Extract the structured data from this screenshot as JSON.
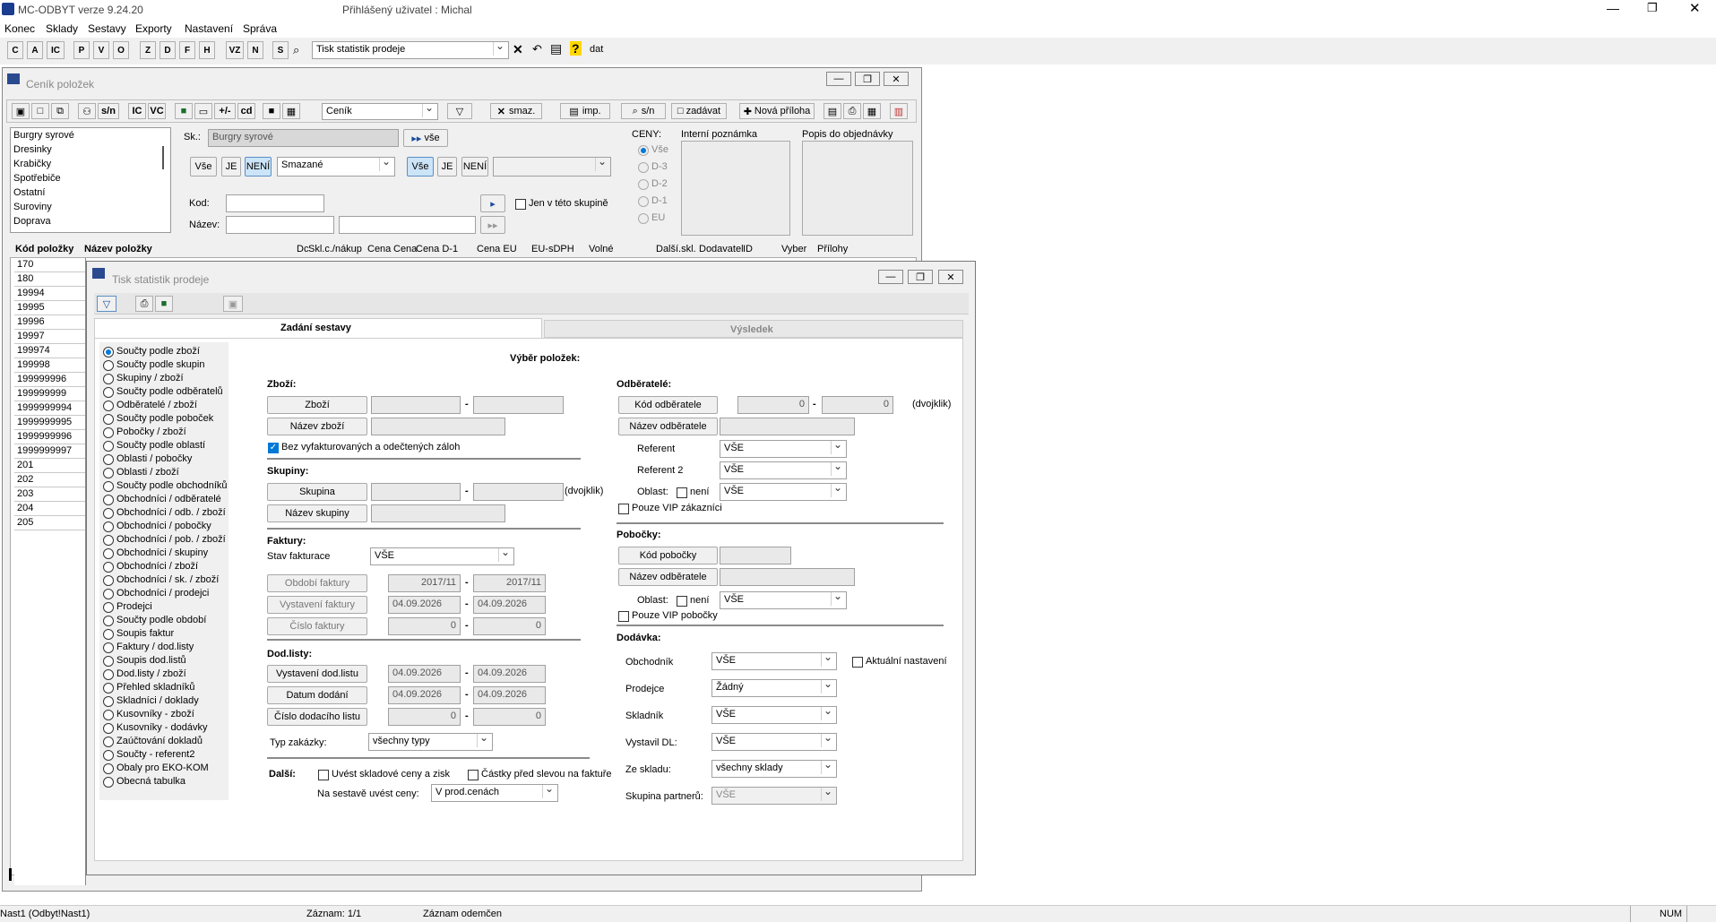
{
  "app": {
    "title": "MC-ODBYT verze 9.24.20",
    "user": "Přihlášený uživatel : Michal"
  },
  "menu": [
    "Konec",
    "Sklady",
    "Sestavy",
    "Exporty",
    "Nastavení",
    "Správa"
  ],
  "toolbar": {
    "letters": [
      "C",
      "A",
      "IC",
      "P",
      "V",
      "O",
      "Z",
      "D",
      "F",
      "H",
      "VZ",
      "N",
      "S"
    ],
    "combo": "Tisk statistik prodeje",
    "dat": "dat"
  },
  "cenik": {
    "title": "Ceník položek",
    "tb": {
      "sn": "s/n",
      "ic": "IC",
      "vc": "VC",
      "pm": "+/-",
      "cd": "cd",
      "combo": "Ceník",
      "smaz": "smaz.",
      "imp": "imp.",
      "sn2": "s/n",
      "zadavat": "zadávat",
      "nova": "Nová příloha"
    },
    "groups": [
      "Burgry syrové",
      "Dresinky",
      "Krabičky",
      "Spotřebiče",
      "Ostatní",
      "Suroviny",
      "Doprava"
    ],
    "sk_label": "Sk.:",
    "sk_value": "Burgry syrové",
    "vse_btn": "vše",
    "filter": {
      "vse": "Vše",
      "je": "JE",
      "neni": "NENÍ",
      "sel": "Smazané",
      "vse2": "Vše",
      "je2": "JE",
      "neni2": "NENÍ"
    },
    "kod": "Kod:",
    "nazev": "Název:",
    "jen": "Jen v této skupině",
    "ceny": {
      "label": "CENY:",
      "opts": [
        "Vše",
        "D-3",
        "D-2",
        "D-1",
        "EU"
      ]
    },
    "interni": "Interní poznámka",
    "popis": "Popis do objednávky",
    "cols": [
      "Kód položky",
      "Název položky",
      "Dc",
      "Skl.c./nákup",
      "Cena",
      "Cena",
      "Cena D-1",
      "Cena EU",
      "EU-sDPH",
      "Volné",
      "Další.skl.",
      "Dodavatel",
      "ID",
      "Vyber",
      "Přílohy"
    ],
    "codes": [
      "170",
      "180",
      "19994",
      "19995",
      "19996",
      "19997",
      "199974",
      "199998",
      "199999996",
      "199999999",
      "1999999994",
      "1999999995",
      "1999999996",
      "1999999997",
      "201",
      "202",
      "203",
      "204",
      "205"
    ]
  },
  "tisk": {
    "title": "Tisk statistik prodeje",
    "tab1": "Zadání sestavy",
    "tab2": "Výsledek",
    "reports": [
      "Součty podle zboží",
      "Součty podle skupin",
      "Skupiny / zboží",
      "Součty podle odběratelů",
      "Odběratelé / zboží",
      "Součty podle poboček",
      "Pobočky / zboží",
      "Součty podle oblastí",
      "Oblasti / pobočky",
      "Oblasti / zboží",
      "Součty podle obchodníků",
      "Obchodníci / odběratelé",
      "Obchodníci / odb. / zboží",
      "Obchodníci / pobočky",
      "Obchodníci / pob. / zboží",
      "Obchodníci / skupiny",
      "Obchodníci / zboží",
      "Obchodníci / sk. / zboží",
      "Obchodníci / prodejci",
      "Prodejci",
      "Součty podle období",
      "Soupis faktur",
      "Faktury / dod.listy",
      "Soupis dod.listů",
      "Dod.listy / zboží",
      "Přehled skladníků",
      "Skladníci / doklady",
      "Kusovníky - zboží",
      "Kusovníky - dodávky",
      "Zaúčtování dokladů",
      "Součty - referent2",
      "Obaly pro EKO-KOM",
      "Obecná tabulka"
    ],
    "vyber": "Výběr položek:",
    "zbozi": {
      "head": "Zboží:",
      "btn1": "Zboží",
      "btn2": "Název zboží",
      "chk": "Bez vyfakturovaných a odečtených záloh"
    },
    "skupiny": {
      "head": "Skupiny:",
      "btn1": "Skupina",
      "btn2": "Název skupiny",
      "dvoj": "(dvojklik)"
    },
    "faktury": {
      "head": "Faktury:",
      "stav": "Stav fakturace",
      "stav_val": "VŠE",
      "obdobi": "Období faktury",
      "obd1": "2017/11",
      "obd2": "2017/11",
      "vyst": "Vystavení faktury",
      "d1": "04.09.2026",
      "d2": "04.09.2026",
      "cislo": "Číslo faktury",
      "c1": "0",
      "c2": "0"
    },
    "dod": {
      "head": "Dod.listy:",
      "vyst": "Vystavení dod.listu",
      "d1": "04.09.2026",
      "d2": "04.09.2026",
      "datum": "Datum dodání",
      "d3": "04.09.2026",
      "d4": "04.09.2026",
      "cislo": "Číslo dodacího listu",
      "c1": "0",
      "c2": "0"
    },
    "typ": {
      "label": "Typ zakázky:",
      "val": "všechny typy"
    },
    "dalsi": {
      "head": "Další:",
      "c1": "Uvést skladové ceny a zisk",
      "c2": "Částky před slevou na faktuře",
      "ceny": "Na sestavě uvést ceny:",
      "ceny_val": "V prod.cenách"
    },
    "odb": {
      "head": "Odběratelé:",
      "kod": "Kód odběratele",
      "k1": "0",
      "k2": "0",
      "dvoj": "(dvojklik)",
      "nazev": "Název odběratele",
      "ref": "Referent",
      "ref_val": "VŠE",
      "ref2": "Referent 2",
      "ref2_val": "VŠE",
      "obl": "Oblast:",
      "neni": "není",
      "obl_val": "VŠE",
      "vip": "Pouze VIP zákazníci"
    },
    "pob": {
      "head": "Pobočky:",
      "kod": "Kód pobočky",
      "nazev": "Název odběratele",
      "obl": "Oblast:",
      "neni": "není",
      "obl_val": "VŠE",
      "vip": "Pouze VIP pobočky"
    },
    "dodavka": {
      "head": "Dodávka:",
      "obch": "Obchodník",
      "obch_val": "VŠE",
      "akt": "Aktuální nastavení",
      "prod": "Prodejce",
      "prod_val": "Žádný",
      "skl": "Skladník",
      "skl_val": "VŠE",
      "vyst": "Vystavil DL:",
      "vyst_val": "VŠE",
      "ze": "Ze skladu:",
      "ze_val": "všechny sklady",
      "skp": "Skupina partnerů:",
      "skp_val": "VŠE"
    }
  },
  "status": {
    "s1": "Nast1 (Odbyt!Nast1)",
    "s2": "Záznam: 1/1",
    "s3": "Záznam odemčen",
    "num": "NUM"
  },
  "colors": {
    "accent": "#0078d7",
    "blue_btn": "#cce4f7"
  }
}
